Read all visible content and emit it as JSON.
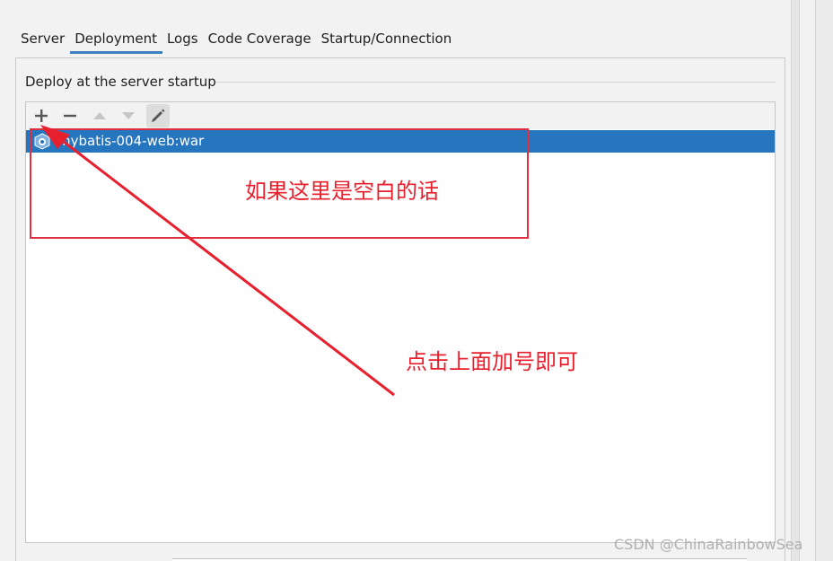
{
  "tabs": [
    "Server",
    "Deployment",
    "Logs",
    "Code Coverage",
    "Startup/Connection"
  ],
  "active_tab": "Deployment",
  "section": {
    "title": "Deploy at the server startup"
  },
  "toolbar": {
    "add_icon": "plus-icon",
    "remove_icon": "minus-icon",
    "up_icon": "arrow-up-icon",
    "down_icon": "arrow-down-icon",
    "edit_icon": "pencil-icon"
  },
  "deployments": [
    {
      "label": "mybatis-004-web:war",
      "icon": "artifact-icon",
      "selected": true
    }
  ],
  "annotations": {
    "box_note": "如果这里是空白的话",
    "arrow_note": "点击上面加号即可",
    "color": "#e8202e"
  },
  "watermark": "CSDN @ChinaRainbowSea",
  "colors": {
    "selection": "#2675bf",
    "tab_underline": "#3d7fc1"
  }
}
